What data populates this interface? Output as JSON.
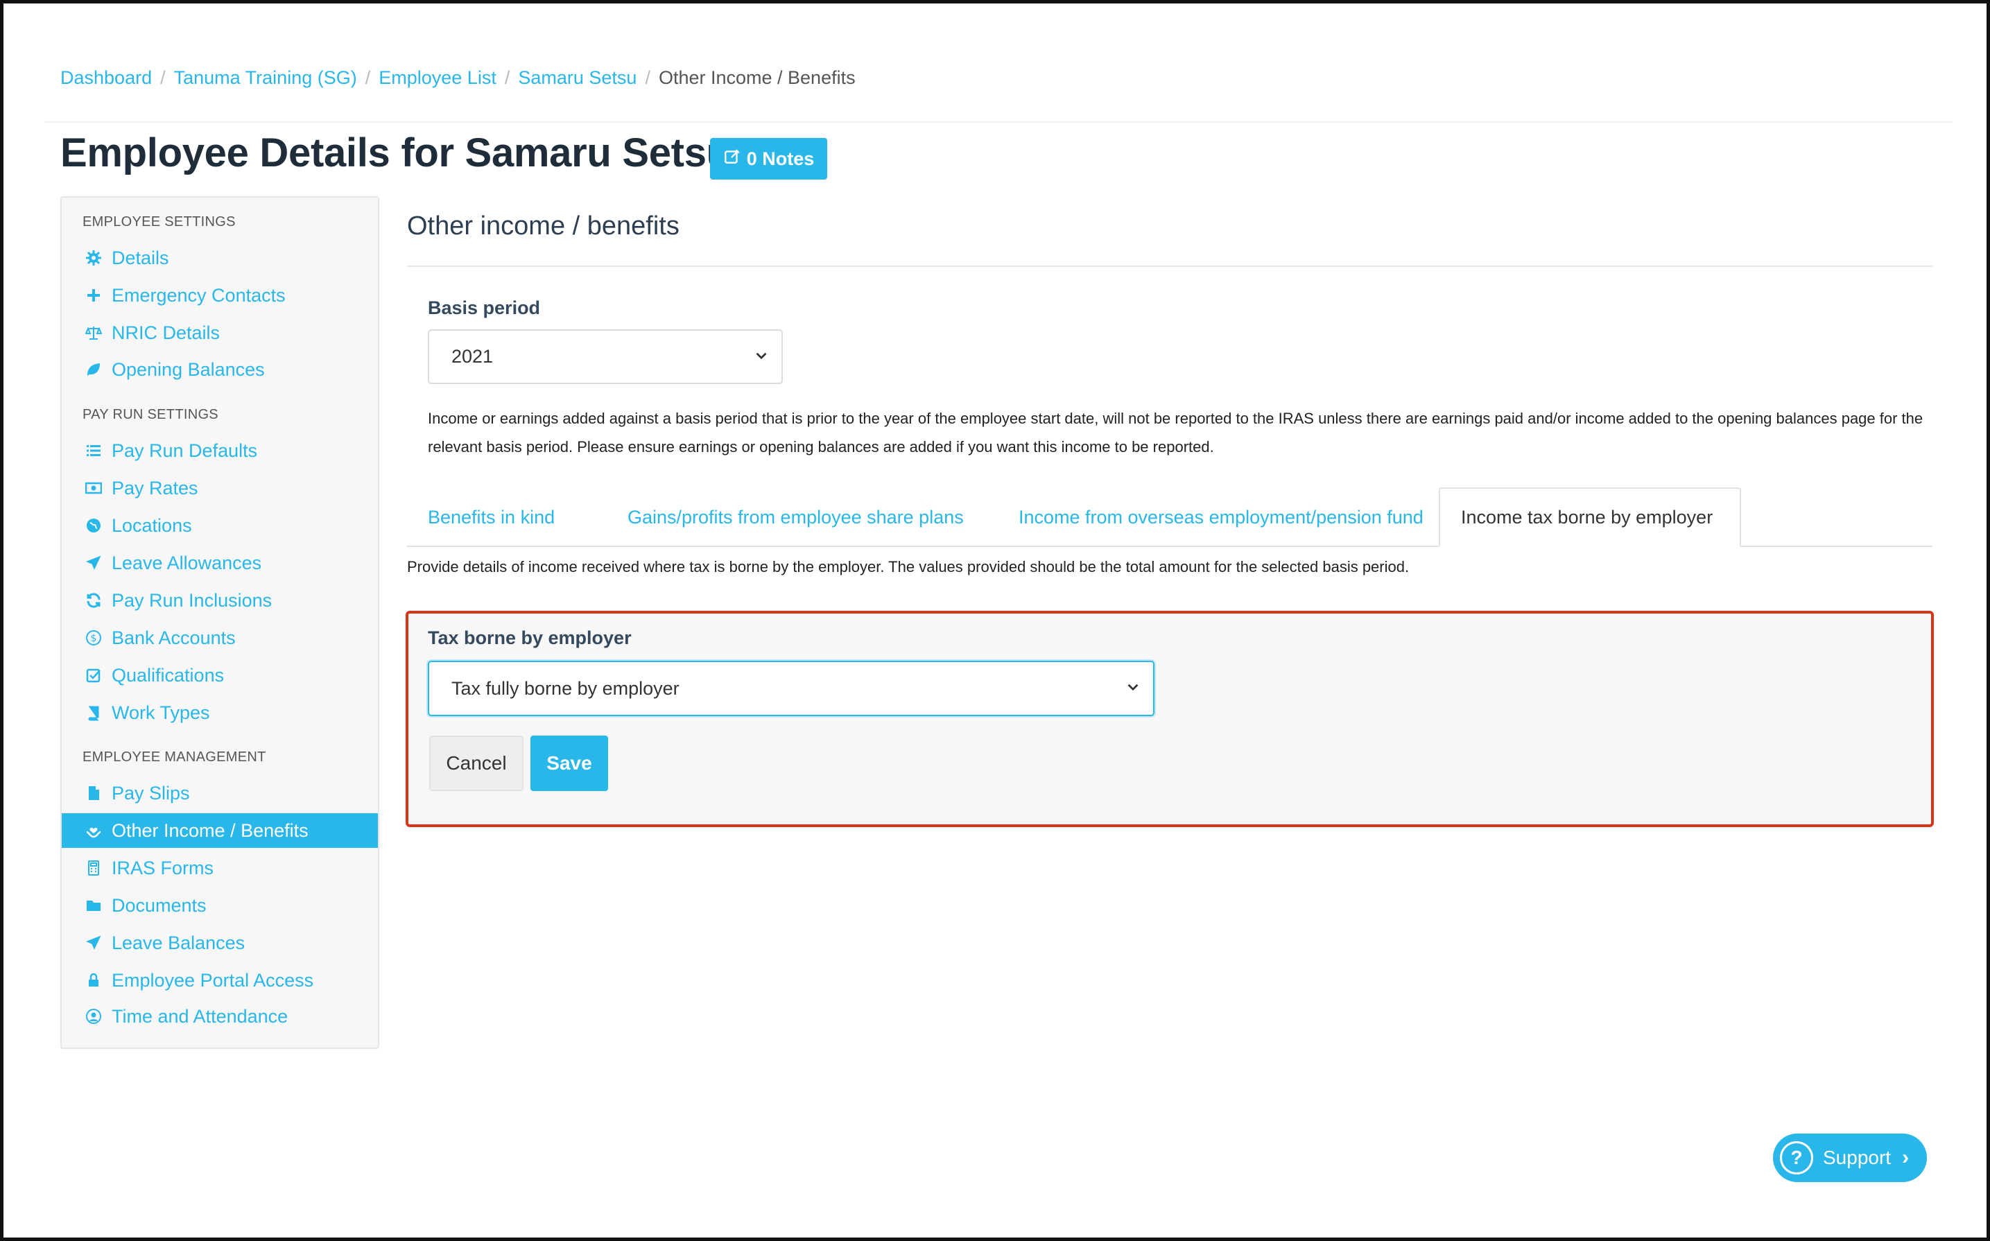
{
  "breadcrumb": [
    {
      "label": "Dashboard"
    },
    {
      "label": "Tanuma Training (SG)"
    },
    {
      "label": "Employee List"
    },
    {
      "label": "Samaru Setsu"
    }
  ],
  "breadcrumb_current": "Other Income / Benefits",
  "page": {
    "title": "Employee Details for Samaru Setsu",
    "notes_label": "0 Notes"
  },
  "sidebar": {
    "sections": [
      {
        "title": "EMPLOYEE SETTINGS"
      },
      {
        "title": "PAY RUN SETTINGS"
      },
      {
        "title": "EMPLOYEE MANAGEMENT"
      }
    ],
    "items": [
      {
        "label": "Details",
        "icon": "gear-icon"
      },
      {
        "label": "Emergency Contacts",
        "icon": "plus-icon"
      },
      {
        "label": "NRIC Details",
        "icon": "scale-icon"
      },
      {
        "label": "Opening Balances",
        "icon": "leaf-icon"
      },
      {
        "label": "Pay Run Defaults",
        "icon": "list-icon"
      },
      {
        "label": "Pay Rates",
        "icon": "money-icon"
      },
      {
        "label": "Locations",
        "icon": "globe-icon"
      },
      {
        "label": "Leave Allowances",
        "icon": "plane-icon"
      },
      {
        "label": "Pay Run Inclusions",
        "icon": "refresh-icon"
      },
      {
        "label": "Bank Accounts",
        "icon": "dollar-circle-icon"
      },
      {
        "label": "Qualifications",
        "icon": "check-square-icon"
      },
      {
        "label": "Work Types",
        "icon": "book-icon"
      },
      {
        "label": "Pay Slips",
        "icon": "file-icon"
      },
      {
        "label": "Other Income / Benefits",
        "icon": "hand-heart-icon",
        "active": true
      },
      {
        "label": "IRAS Forms",
        "icon": "calculator-icon"
      },
      {
        "label": "Documents",
        "icon": "folder-icon"
      },
      {
        "label": "Leave Balances",
        "icon": "plane-icon"
      },
      {
        "label": "Employee Portal Access",
        "icon": "lock-icon"
      },
      {
        "label": "Time and Attendance",
        "icon": "user-clock-icon"
      }
    ]
  },
  "main": {
    "section_title": "Other income / benefits",
    "basis_period_label": "Basis period",
    "basis_period_value": "2021",
    "info_text": "Income or earnings added against a basis period that is prior to the year of the employee start date, will not be reported to the IRAS unless there are earnings paid and/or income added to the opening balances page for the relevant basis period. Please ensure earnings or opening balances are added if you want this income to be reported.",
    "tabs": [
      {
        "label": "Benefits in kind"
      },
      {
        "label": "Gains/profits from employee share plans"
      },
      {
        "label": "Income from overseas employment/pension fund"
      },
      {
        "label": "Income tax borne by employer",
        "active": true
      }
    ],
    "provide_text": "Provide details of income received where tax is borne by the employer. The values provided should be the total amount for the selected basis period.",
    "form": {
      "tax_label": "Tax borne by employer",
      "tax_value": "Tax fully borne by employer",
      "cancel_label": "Cancel",
      "save_label": "Save"
    }
  },
  "support": {
    "label": "Support"
  },
  "colors": {
    "accent": "#29b6e8",
    "highlight_border": "#d9331a"
  }
}
